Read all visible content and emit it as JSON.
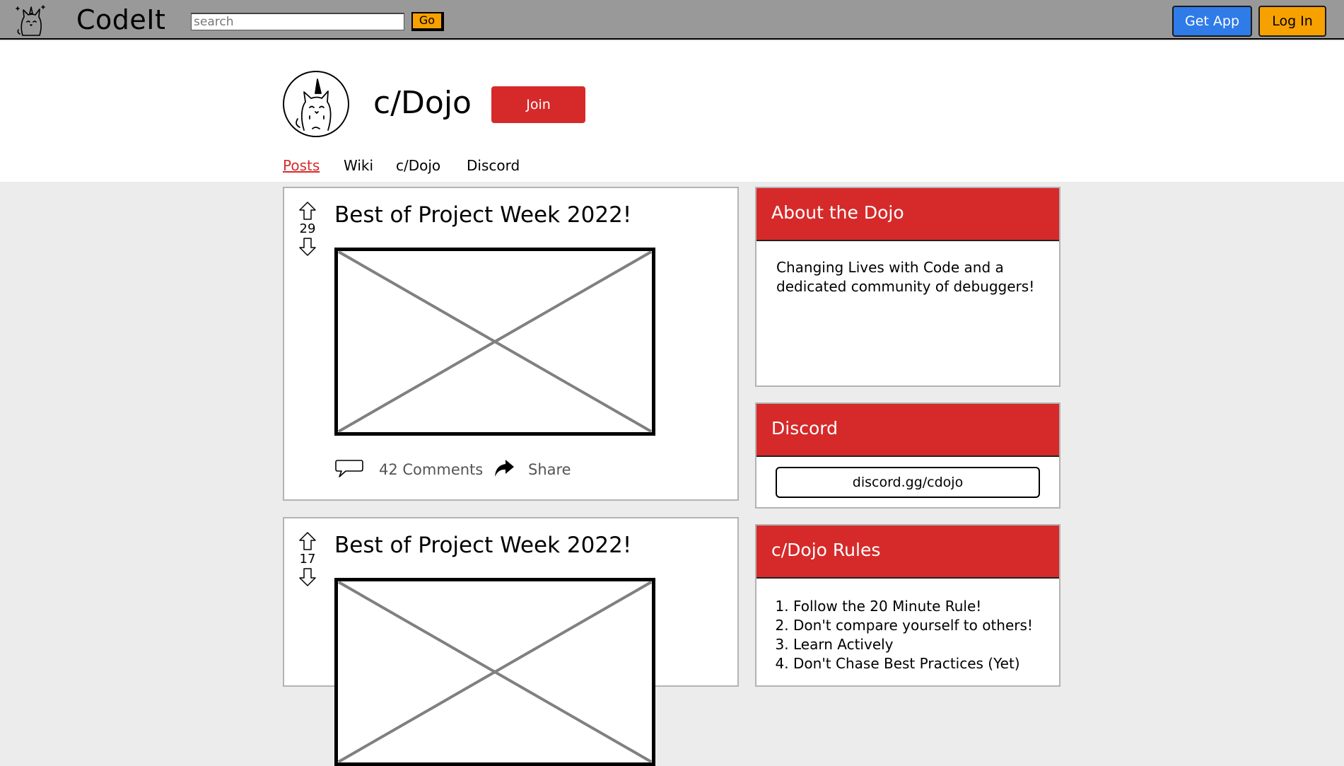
{
  "topbar": {
    "brand": "CodeIt",
    "search_placeholder": "search",
    "go_label": "Go",
    "get_app_label": "Get App",
    "login_label": "Log In",
    "logo_icon": "unicorn-cat-icon"
  },
  "community": {
    "name": "c/Dojo",
    "join_label": "Join",
    "avatar_icon": "unicorn-cat-icon",
    "tabs": [
      {
        "label": "Posts",
        "active": true
      },
      {
        "label": "Wiki",
        "active": false
      },
      {
        "label": "c/Dojo",
        "active": false
      },
      {
        "label": "Discord",
        "active": false
      }
    ]
  },
  "posts": [
    {
      "title": "Best of Project Week 2022!",
      "votes": "29",
      "comments_label": "42 Comments",
      "share_label": "Share"
    },
    {
      "title": "Best of Project Week 2022!",
      "votes": "17"
    }
  ],
  "sidebar": {
    "about": {
      "title": "About the Dojo",
      "text": "Changing Lives with Code and a dedicated community of debuggers!"
    },
    "discord": {
      "title": "Discord",
      "link_label": "discord.gg/cdojo"
    },
    "rules": {
      "title": "c/Dojo Rules",
      "items": [
        "Follow the 20 Minute Rule!",
        "Don't compare yourself to others!",
        "Learn Actively",
        "Don't Chase Best Practices (Yet)"
      ]
    }
  },
  "colors": {
    "topbar": "#999999",
    "accent_red": "#d62a2a",
    "accent_orange": "#f7a100",
    "accent_blue": "#2f7be8",
    "page_bg": "#ececec"
  }
}
